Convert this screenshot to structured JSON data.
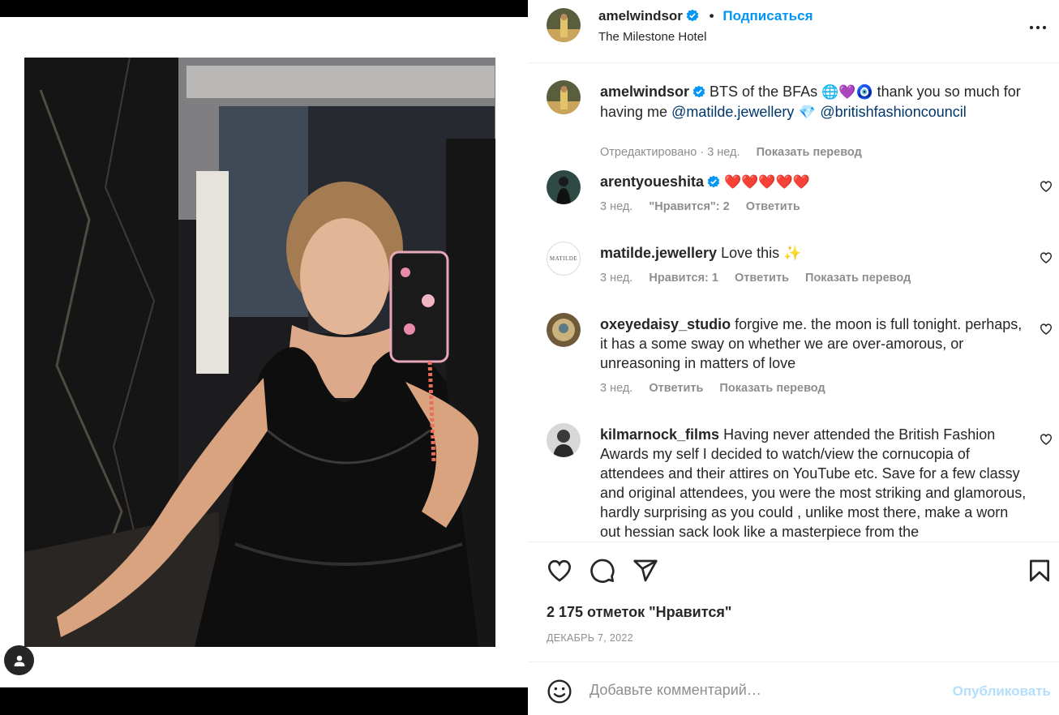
{
  "post": {
    "username": "amelwindsor",
    "follow_label": "Подписаться",
    "dot": "•",
    "location": "The Milestone Hotel"
  },
  "caption": {
    "username": "amelwindsor",
    "text_line1": "BTS of the BFAs",
    "emojis": "🌐💜🧿",
    "text_line1b": " thank you so much for",
    "text_line2a": "having me ",
    "mention1": "@matilde.jewellery",
    "diamond": " 💎 ",
    "mention2": "@britishfashioncouncil",
    "meta_edited": "Отредактировано · 3 нед.",
    "meta_translate": "Показать перевод"
  },
  "comments": [
    {
      "username": "arentyoueshita",
      "text": "❤️❤️❤️❤️❤️",
      "time": "3 нед.",
      "likes": "\"Нравится\": 2",
      "reply": "Ответить"
    },
    {
      "username": "matilde.jewellery",
      "text": "Love this ✨",
      "time": "3 нед.",
      "likes": "Нравится: 1",
      "reply": "Ответить",
      "translate": "Показать перевод",
      "avatar_text": "MATILDE"
    },
    {
      "username": "oxeyedaisy_studio",
      "text": "forgive me. the moon is full tonight. perhaps, it has a some sway on whether we are over-amorous, or unreasoning in matters of love",
      "time": "3 нед.",
      "reply": "Ответить",
      "translate": "Показать перевод"
    },
    {
      "username": "kilmarnock_films",
      "text": "Having never attended the British Fashion Awards my self I decided to watch/view the cornucopia of attendees and their attires on YouTube etc. Save for a few classy and original attendees, you were the most striking and glamorous, hardly surprising as you could , unlike most there, make a worn out hessian sack look like a masterpiece from the"
    }
  ],
  "actions": {
    "likes_count": "2 175 отметок \"Нравится\"",
    "date": "ДЕКАБРЬ 7, 2022"
  },
  "add_comment": {
    "placeholder": "Добавьте комментарий…",
    "post_label": "Опубликовать"
  }
}
